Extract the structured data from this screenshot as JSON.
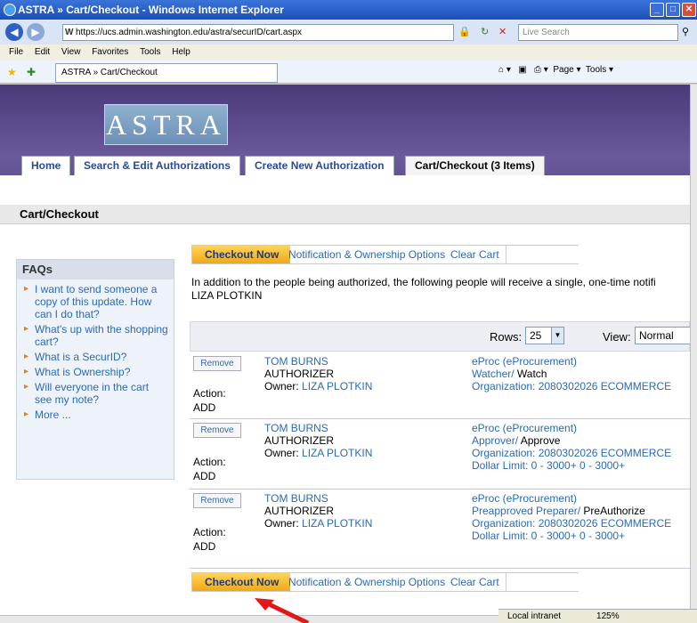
{
  "window": {
    "title": "ASTRA » Cart/Checkout - Windows Internet Explorer"
  },
  "browser": {
    "url": "https://ucs.admin.washington.edu/astra/securID/cart.aspx",
    "search_placeholder": "Live Search",
    "menu": [
      "File",
      "Edit",
      "View",
      "Favorites",
      "Tools",
      "Help"
    ],
    "tab_title": "ASTRA » Cart/Checkout",
    "tools": [
      "Page ▾",
      "Tools ▾"
    ],
    "status": "Local intranet",
    "zoom": "125%"
  },
  "site": {
    "logo": "ASTRA",
    "nav": [
      "Home",
      "Search & Edit Authorizations",
      "Create New Authorization",
      "Cart/Checkout (3 Items)"
    ]
  },
  "page": {
    "heading": "Cart/Checkout",
    "checkout_label": "Checkout Now",
    "notify_label": "Notification & Ownership Options",
    "clear_label": "Clear Cart",
    "info_line": "In addition to the people being authorized, the following people will receive a single, one-time notifi",
    "info_name": "LIZA PLOTKIN",
    "rows_label": "Rows:",
    "rows_value": "25",
    "view_label": "View:",
    "view_value": "Normal"
  },
  "faq": {
    "title": "FAQs",
    "items": [
      "I want to send someone a copy of this update. How can I do that?",
      "What's up with the shopping cart?",
      "What is a SecurID?",
      "What is Ownership?",
      "Will everyone in the cart see my note?",
      "More ..."
    ]
  },
  "cart": [
    {
      "remove": "Remove",
      "action_label": "Action:",
      "action": "ADD",
      "name": "TOM BURNS",
      "role": "AUTHORIZER",
      "owner_label": "Owner:",
      "owner": "LIZA PLOTKIN",
      "system": "eProc (eProcurement)",
      "perm": "Watcher/",
      "perm_text": " Watch",
      "org": "Organization: 2080302026 ECOMMERCE",
      "limit": ""
    },
    {
      "remove": "Remove",
      "action_label": "Action:",
      "action": "ADD",
      "name": "TOM BURNS",
      "role": "AUTHORIZER",
      "owner_label": "Owner:",
      "owner": "LIZA PLOTKIN",
      "system": "eProc (eProcurement)",
      "perm": "Approver/",
      "perm_text": " Approve",
      "org": "Organization: 2080302026 ECOMMERCE",
      "limit": "Dollar Limit: 0 - 3000+ 0 - 3000+"
    },
    {
      "remove": "Remove",
      "action_label": "Action:",
      "action": "ADD",
      "name": "TOM BURNS",
      "role": "AUTHORIZER",
      "owner_label": "Owner:",
      "owner": "LIZA PLOTKIN",
      "system": "eProc (eProcurement)",
      "perm": "Preapproved Preparer/",
      "perm_text": " PreAuthorize",
      "org": "Organization: 2080302026 ECOMMERCE",
      "limit": "Dollar Limit: 0 - 3000+ 0 - 3000+"
    }
  ]
}
